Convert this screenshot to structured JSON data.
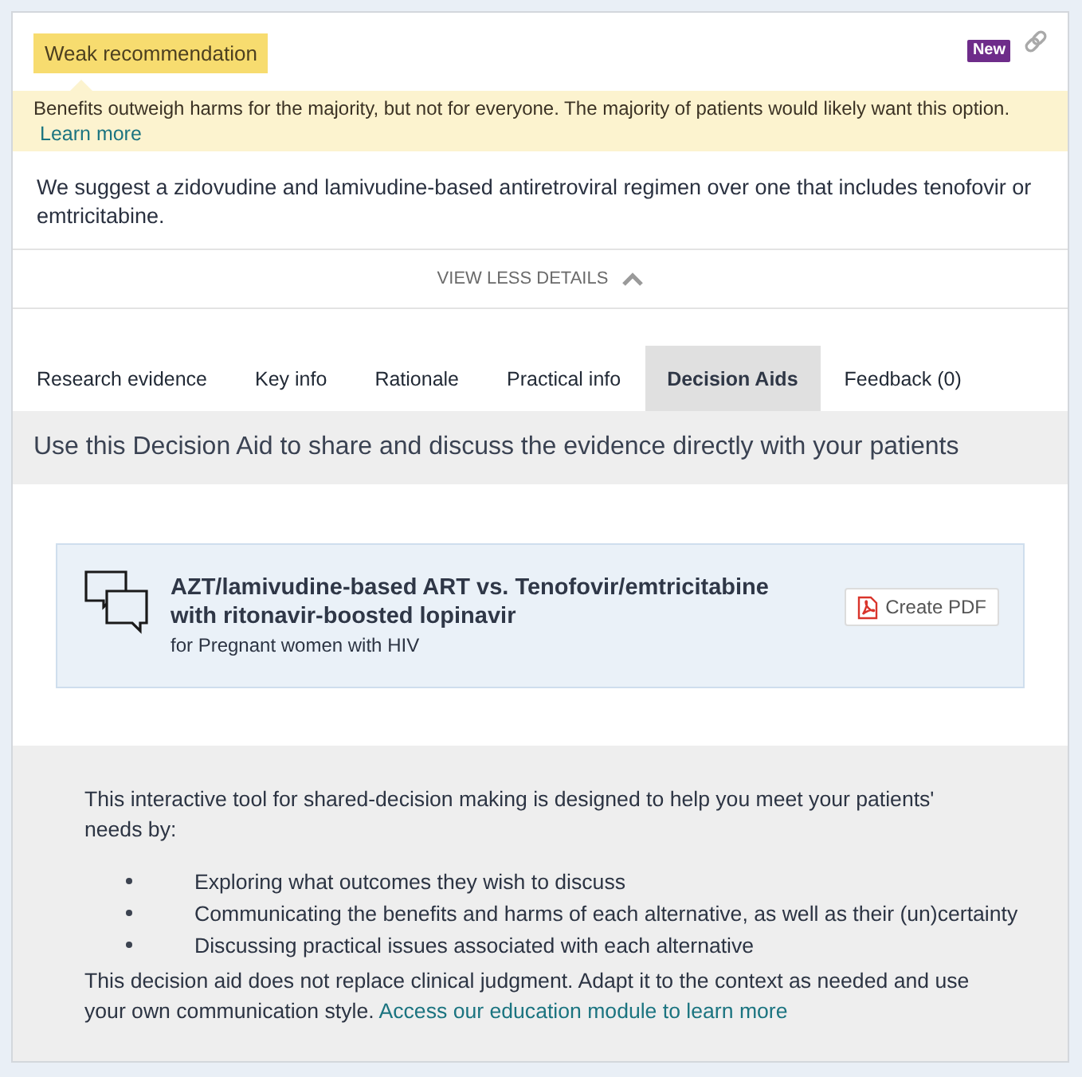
{
  "recommendation": {
    "strength_badge": "Weak recommendation",
    "new_badge": "New",
    "explanation": "Benefits outweigh harms for the majority, but not for everyone. The majority of patients would likely want this option.",
    "learn_more_link": "Learn more",
    "statement": "We suggest a zidovudine and lamivudine-based antiretroviral regimen over one that includes tenofovir or emtricitabine."
  },
  "details_toggle": {
    "label": "VIEW LESS DETAILS",
    "expanded": true
  },
  "tabs": [
    {
      "label": "Research evidence",
      "selected": false
    },
    {
      "label": "Key info",
      "selected": false
    },
    {
      "label": "Rationale",
      "selected": false
    },
    {
      "label": "Practical info",
      "selected": false
    },
    {
      "label": "Decision Aids",
      "selected": true
    },
    {
      "label": "Feedback (0)",
      "selected": false
    }
  ],
  "decision_aids": {
    "intro": "Use this Decision Aid to share and discuss the evidence directly with your patients",
    "aid": {
      "title": "AZT/lamivudine-based ART vs. Tenofovir/emtricitabine with ritonavir-boosted lopinavir",
      "subtitle": "for Pregnant women with HIV",
      "pdf_button": "Create PDF"
    },
    "description": "This interactive tool for shared-decision making is designed to help you meet your patients' needs by:",
    "bullets": [
      "Exploring what outcomes they wish to discuss",
      "Communicating the benefits and harms of each alternative, as well as their (un)certainty",
      "Discussing practical issues associated with each alternative"
    ],
    "closing": "This decision aid does not replace clinical judgment. Adapt it to the context as needed and use your own communication style.",
    "closing_link": "Access our education module to learn more"
  }
}
